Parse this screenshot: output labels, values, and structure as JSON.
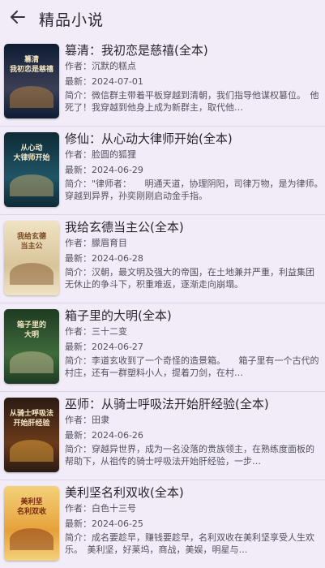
{
  "header": {
    "title": "精品小说",
    "back_icon": "arrow-left-icon"
  },
  "books": [
    {
      "title": "篡清：我初恋是慈禧(全本)",
      "author": "作者：沉默的糕点",
      "date": "最新：2024-07-01",
      "intro": "简介：微信群主带着平板穿越到清朝，我们指导他谋权篡位。　他死了！我穿越到他身上成为新群主，取代他…",
      "cover_text": "篡清\n我初恋是慈禧",
      "cover_colors": [
        "#0e1c33",
        "#3a3f55",
        "#c98a3a"
      ]
    },
    {
      "title": "修仙：从心动大律师开始(全本)",
      "author": "作者：脸圆的狐狸",
      "date": "最新：2024-06-29",
      "intro": "简介：\"律师者：　　明通天道，协理阴阳，司律万物，是为律师。　　穿越到异界，孙奕刚刚启动金手指。",
      "cover_text": "从心动\n大律师开始",
      "cover_colors": [
        "#0f2a36",
        "#1f5566",
        "#d8b46a"
      ]
    },
    {
      "title": "我给玄德当主公(全本)",
      "author": "作者：朦眉育目",
      "date": "最新：2024-06-28",
      "intro": "简介：汉朝，最文明及强大的帝国，在土地兼并严重，利益集团无休止的争斗下，积重难返，逐渐走向崩塌。",
      "cover_text": "我给玄德\n当主公",
      "cover_colors": [
        "#efe3c4",
        "#d9c49a",
        "#7a4a22"
      ]
    },
    {
      "title": "箱子里的大明(全本)",
      "author": "作者：三十二变",
      "date": "最新：2024-06-27",
      "intro": "简介：李道玄收到了一个奇怪的造景箱。　　箱子里有一个古代的村庄，还有一群塑料小人，提着刀剑，在村…",
      "cover_text": "箱子里的\n大明",
      "cover_colors": [
        "#1e3b22",
        "#3f6a3b",
        "#d7c9a0"
      ]
    },
    {
      "title": "巫师：从骑士呼吸法开始肝经验(全本)",
      "author": "作者：田隶",
      "date": "最新：2024-06-26",
      "intro": "简介：穿越异世界，成为一名没落的贵族领主，在熟练度面板的帮助下，从祖传的骑士呼吸法开始肝经验，一步…",
      "cover_text": "从骑士呼吸法\n开始肝经验",
      "cover_colors": [
        "#2b1a14",
        "#6a3a1a",
        "#f0b040"
      ]
    },
    {
      "title": "美利坚名利双收(全本)",
      "author": "作者：白色十三号",
      "date": "最新：2024-06-25",
      "intro": "简介：成名要趁早，赚钱要趁早，名利双收在美利坚享受人生欢乐。　美利坚，好莱坞，商战，美娱，明星与…",
      "cover_text": "美利坚\n名利双收",
      "cover_colors": [
        "#f3d27a",
        "#e6a03a",
        "#7a2a10"
      ]
    }
  ]
}
